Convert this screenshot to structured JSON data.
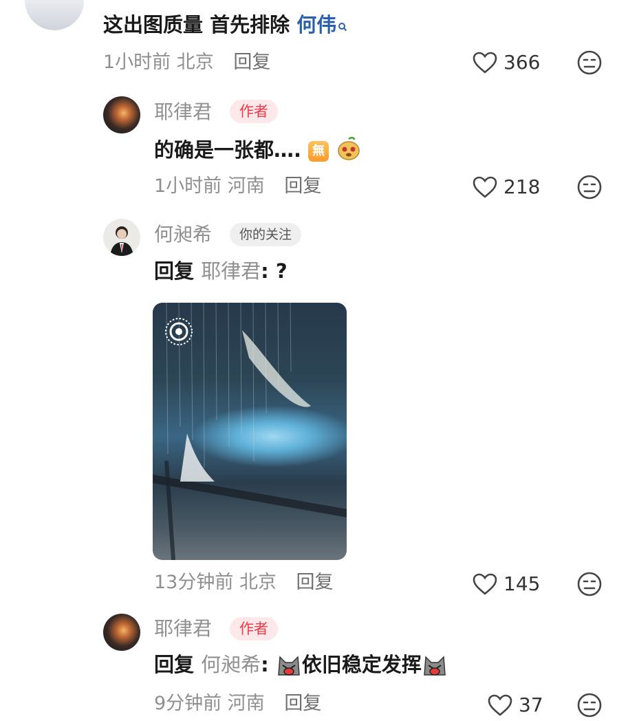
{
  "comments": [
    {
      "text_main": "这出图质量 首先排除 ",
      "mention": "何伟",
      "time": "1小时前",
      "location": "北京",
      "reply_label": "回复",
      "likes": "366"
    },
    {
      "author": "耶律君",
      "badge": "作者",
      "text_main": "的确是一张都….",
      "emoji_1": "無",
      "time": "1小时前",
      "location": "河南",
      "reply_label": "回复",
      "likes": "218"
    },
    {
      "author": "何昶希",
      "badge": "你的关注",
      "reply_prefix": "回复 ",
      "reply_to": "耶律君",
      "text_main": ": ?",
      "time": "13分钟前",
      "location": "北京",
      "reply_label": "回复",
      "likes": "145"
    },
    {
      "author": "耶律君",
      "badge": "作者",
      "reply_prefix": "回复 ",
      "reply_to": "何昶希",
      "colon": ":",
      "text_main": "依旧稳定发挥",
      "time": "9分钟前",
      "location": "河南",
      "reply_label": "回复",
      "likes": "37"
    }
  ],
  "icons": {
    "like": "heart-outline-icon",
    "dislike": "neutral-face-icon",
    "search": "search-small-icon",
    "live": "live-photo-icon"
  },
  "colors": {
    "mention": "#2d5fa8",
    "author_badge_bg": "#fde8ea",
    "author_badge_text": "#ee3b4a"
  }
}
